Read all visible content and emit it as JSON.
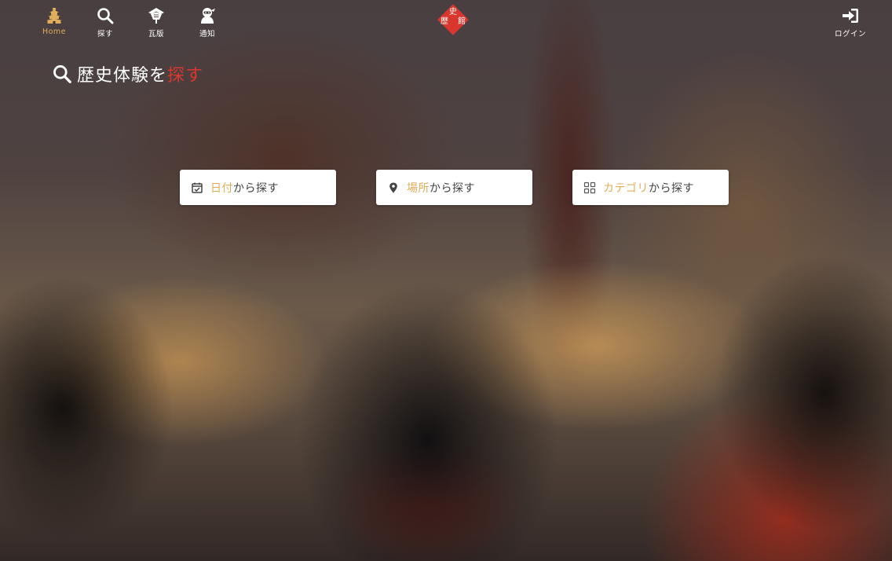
{
  "nav": {
    "home": "Home",
    "search": "探す",
    "kawaraban": "瓦版",
    "notify": "通知",
    "login": "ログイン"
  },
  "logo": {
    "chars": [
      "史",
      "歴",
      "館"
    ],
    "color": "#d9372e"
  },
  "headline": {
    "main": "歴史体験を",
    "accent": "探す"
  },
  "search_buttons": [
    {
      "icon": "calendar-check-icon",
      "accent": "日付",
      "text": "から探す"
    },
    {
      "icon": "map-pin-icon",
      "accent": "場所",
      "text": "から探す"
    },
    {
      "icon": "grid-icon",
      "accent": "カテゴリ",
      "text": "から探す"
    }
  ],
  "colors": {
    "accent_gold": "#e0ad5b",
    "accent_red": "#d9372e",
    "button_bg": "#ffffff",
    "button_text": "#444444"
  }
}
